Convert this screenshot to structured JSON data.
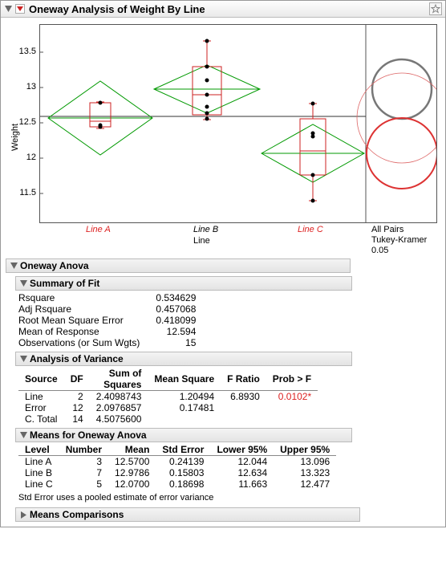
{
  "title": "Oneway Analysis of Weight By Line",
  "y_axis_label": "Weight",
  "x_axis_label": "Line",
  "y_ticks": [
    "11.5",
    "12",
    "12.5",
    "13",
    "13.5"
  ],
  "x_categories": [
    "Line A",
    "Line B",
    "Line C"
  ],
  "comparison_label_1": "All Pairs",
  "comparison_label_2": "Tukey-Kramer",
  "comparison_label_3": "0.05",
  "sections": {
    "anova": "Oneway Anova",
    "summary": "Summary of Fit",
    "aov": "Analysis of Variance",
    "means": "Means for Oneway Anova",
    "comparisons": "Means Comparisons"
  },
  "summary_fit": {
    "rows": [
      {
        "label": "Rsquare",
        "value": "0.534629"
      },
      {
        "label": "Adj Rsquare",
        "value": "0.457068"
      },
      {
        "label": "Root Mean Square Error",
        "value": "0.418099"
      },
      {
        "label": "Mean of Response",
        "value": "12.594"
      },
      {
        "label": "Observations (or Sum Wgts)",
        "value": "15"
      }
    ]
  },
  "aov_headers": [
    "Source",
    "DF",
    "Sum of Squares",
    "Mean Square",
    "F Ratio",
    "Prob > F"
  ],
  "aov_rows": [
    {
      "source": "Line",
      "df": "2",
      "ss": "2.4098743",
      "ms": "1.20494",
      "f": "6.8930",
      "p": "0.0102*",
      "sig": true
    },
    {
      "source": "Error",
      "df": "12",
      "ss": "2.0976857",
      "ms": "0.17481",
      "f": "",
      "p": "",
      "sig": false
    },
    {
      "source": "C. Total",
      "df": "14",
      "ss": "4.5075600",
      "ms": "",
      "f": "",
      "p": "",
      "sig": false
    }
  ],
  "means_headers": [
    "Level",
    "Number",
    "Mean",
    "Std Error",
    "Lower 95%",
    "Upper 95%"
  ],
  "means_rows": [
    {
      "level": "Line A",
      "n": "3",
      "mean": "12.5700",
      "se": "0.24139",
      "lo": "12.044",
      "hi": "13.096"
    },
    {
      "level": "Line B",
      "n": "7",
      "mean": "12.9786",
      "se": "0.15803",
      "lo": "12.634",
      "hi": "13.323"
    },
    {
      "level": "Line C",
      "n": "5",
      "mean": "12.0700",
      "se": "0.18698",
      "lo": "11.663",
      "hi": "12.477"
    }
  ],
  "footnote": "Std Error uses a pooled estimate of error variance",
  "chart_data": {
    "type": "boxplot",
    "title": "Oneway Analysis of Weight By Line",
    "xlabel": "Line",
    "ylabel": "Weight",
    "ylim": [
      11.3,
      13.8
    ],
    "y_ticks": [
      11.5,
      12,
      12.5,
      13,
      13.5
    ],
    "categories": [
      "Line A",
      "Line B",
      "Line C"
    ],
    "grand_mean": 12.594,
    "group_means": [
      12.57,
      12.9786,
      12.07
    ],
    "boxes": [
      {
        "category": "Line A",
        "min": 12.42,
        "q1": 12.45,
        "median": 12.5,
        "q3": 12.78,
        "max": 12.8,
        "points": [
          12.45,
          12.47,
          12.8
        ]
      },
      {
        "category": "Line B",
        "min": 12.55,
        "q1": 12.7,
        "median": 12.9,
        "q3": 13.3,
        "max": 13.65,
        "points": [
          12.55,
          12.62,
          12.72,
          12.9,
          13.1,
          13.3,
          13.65
        ]
      },
      {
        "category": "Line C",
        "min": 11.4,
        "q1": 11.75,
        "median": 12.1,
        "q3": 12.55,
        "max": 12.78,
        "points": [
          11.4,
          11.75,
          12.3,
          12.35,
          12.78
        ]
      }
    ],
    "mean_diamonds": [
      {
        "category": "Line A",
        "mean": 12.57,
        "lo": 12.044,
        "hi": 13.096
      },
      {
        "category": "Line B",
        "mean": 12.9786,
        "lo": 12.634,
        "hi": 13.323
      },
      {
        "category": "Line C",
        "mean": 12.07,
        "lo": 11.663,
        "hi": 12.477
      }
    ],
    "comparison_circles": {
      "method": "Tukey-Kramer",
      "alpha": 0.05,
      "circles": [
        {
          "group": "Line B",
          "center": 12.98,
          "radius_display": 0.42,
          "color": "gray"
        },
        {
          "group": "Line A",
          "center": 12.57,
          "radius_display": 0.64,
          "color": "red_thin"
        },
        {
          "group": "Line C",
          "center": 12.07,
          "radius_display": 0.5,
          "color": "red"
        }
      ]
    }
  }
}
